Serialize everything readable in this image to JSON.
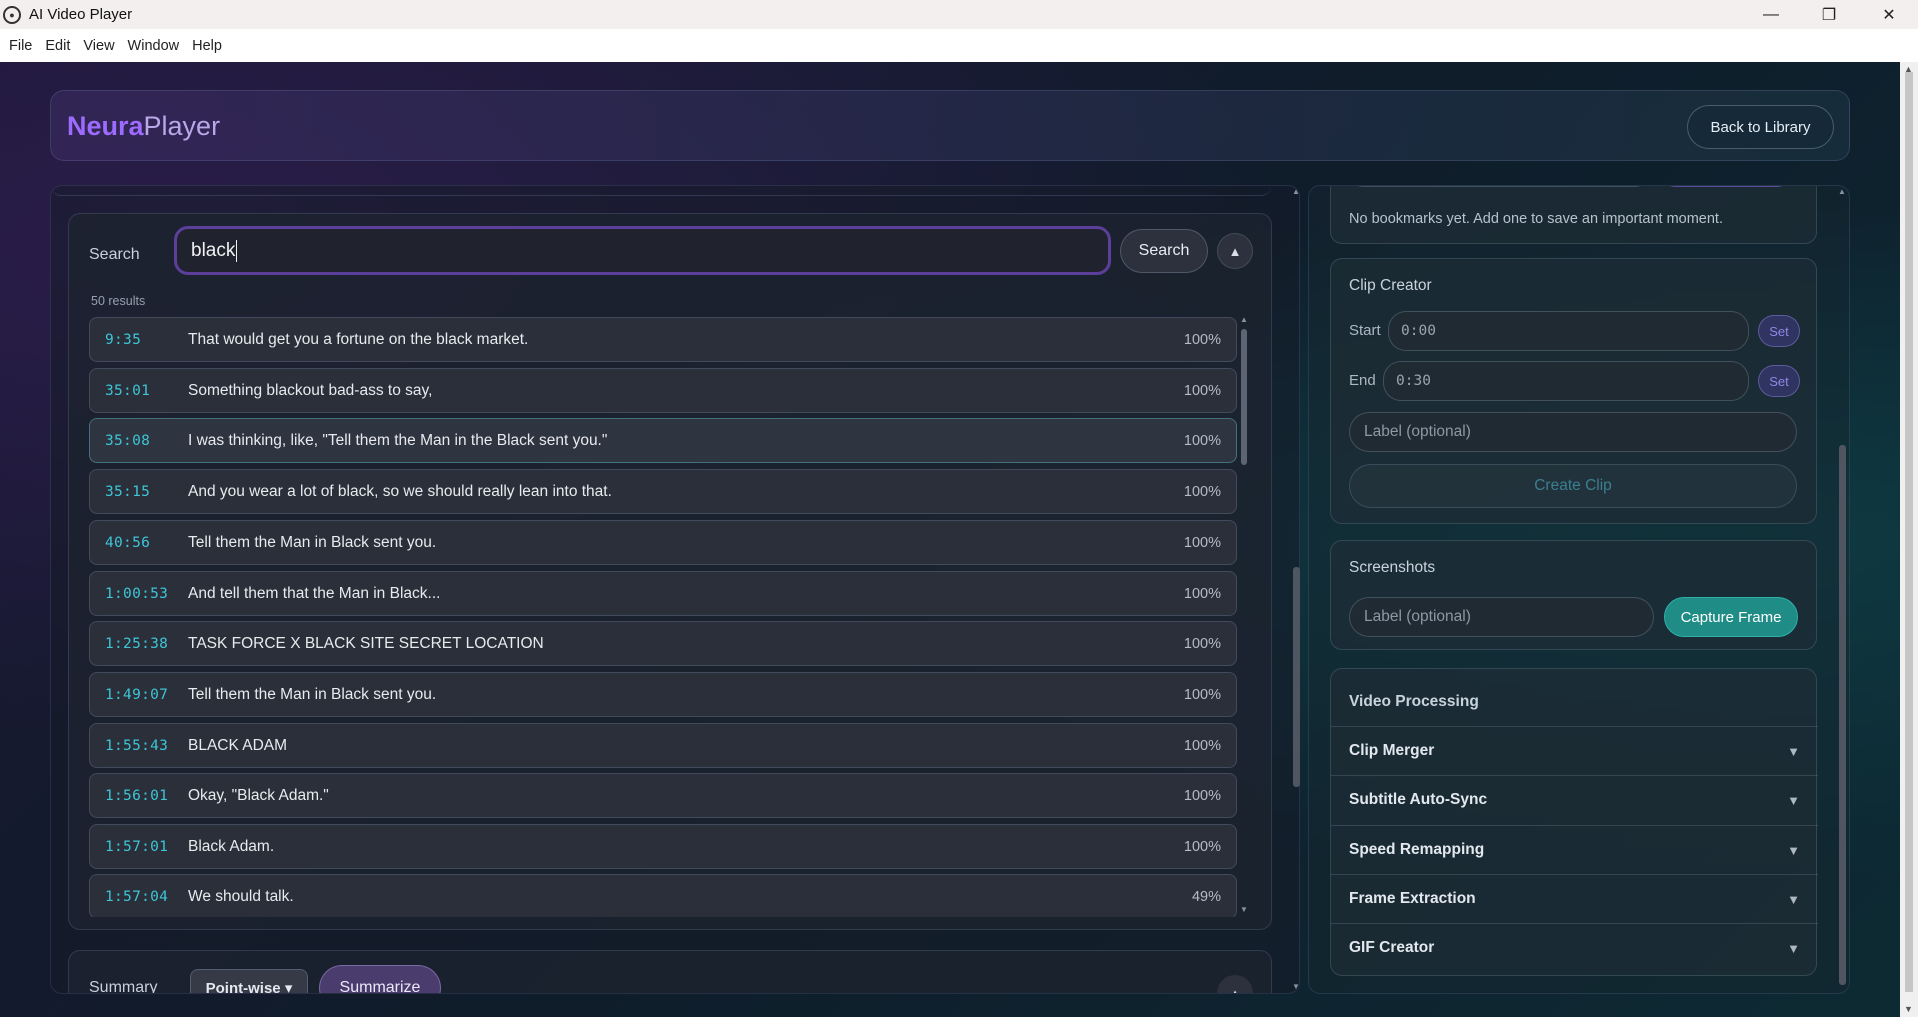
{
  "window": {
    "title": "AI Video Player",
    "controls": {
      "minimize": "—",
      "maximize": "❐",
      "close": "✕"
    }
  },
  "menu": [
    "File",
    "Edit",
    "View",
    "Window",
    "Help"
  ],
  "header": {
    "logo_part1": "Neura",
    "logo_part2": "Player",
    "back_label": "Back to Library"
  },
  "search": {
    "label": "Search",
    "query": "black",
    "button_label": "Search",
    "collapse_icon": "▲",
    "result_count": "50 results",
    "results": [
      {
        "time": "9:35",
        "text": "That would get you a fortune on the black market.",
        "score": "100%"
      },
      {
        "time": "35:01",
        "text": "Something blackout bad-ass to say,",
        "score": "100%"
      },
      {
        "time": "35:08",
        "text": "I was thinking, like, \"Tell them the Man in the Black sent you.\"",
        "score": "100%"
      },
      {
        "time": "35:15",
        "text": "And you wear a lot of black, so we should really lean into that.",
        "score": "100%"
      },
      {
        "time": "40:56",
        "text": "Tell them the Man in Black sent you.",
        "score": "100%"
      },
      {
        "time": "1:00:53",
        "text": "And tell them that the Man in Black...",
        "score": "100%"
      },
      {
        "time": "1:25:38",
        "text": "TASK FORCE X BLACK SITE SECRET LOCATION",
        "score": "100%"
      },
      {
        "time": "1:49:07",
        "text": "Tell them the Man in Black sent you.",
        "score": "100%"
      },
      {
        "time": "1:55:43",
        "text": "BLACK ADAM",
        "score": "100%"
      },
      {
        "time": "1:56:01",
        "text": "Okay, \"Black Adam.\"",
        "score": "100%"
      },
      {
        "time": "1:57:01",
        "text": "Black Adam.",
        "score": "100%"
      },
      {
        "time": "1:57:04",
        "text": "We should talk.",
        "score": "49%"
      }
    ]
  },
  "summary": {
    "label": "Summary",
    "mode": "Point-wise ▾",
    "button_label": "Summarize",
    "collapse_icon": "▲"
  },
  "bookmarks": {
    "empty_text": "No bookmarks yet. Add one to save an important moment."
  },
  "clip_creator": {
    "title": "Clip Creator",
    "start_label": "Start",
    "start_value": "0:00",
    "end_label": "End",
    "end_value": "0:30",
    "set_label": "Set",
    "label_placeholder": "Label (optional)",
    "create_label": "Create Clip"
  },
  "screenshots": {
    "title": "Screenshots",
    "label_placeholder": "Label (optional)",
    "capture_label": "Capture Frame"
  },
  "video_processing": {
    "title": "Video Processing",
    "items": [
      "Clip Merger",
      "Subtitle Auto-Sync",
      "Speed Remapping",
      "Frame Extraction",
      "GIF Creator"
    ],
    "chevron": "▼"
  },
  "colors": {
    "accent_purple": "#9d6bff",
    "timestamp_cyan": "#3ec5d6",
    "capture_teal": "#1f8c86"
  }
}
